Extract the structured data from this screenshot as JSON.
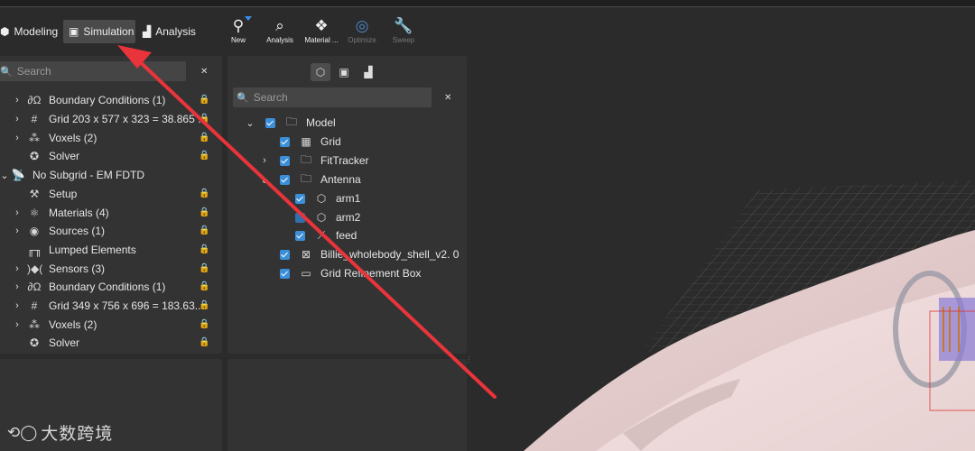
{
  "modes": {
    "modeling": "Modeling",
    "simulation": "Simulation",
    "analysis": "Analysis"
  },
  "tools": {
    "new": "New",
    "analysis": "Analysis",
    "material": "Material ...",
    "optimize": "Optimize",
    "sweep": "Sweep"
  },
  "left_panel": {
    "search_placeholder": "Search",
    "items": [
      {
        "label": "Boundary Conditions (1)",
        "icon": "boundary-conditions-icon"
      },
      {
        "label": "Grid 203 x 577 x 323 = 38.865 ...",
        "icon": "grid-icon"
      },
      {
        "label": "Voxels (2)",
        "icon": "voxels-icon"
      },
      {
        "label": "Solver",
        "icon": "solver-icon"
      },
      {
        "label": "No Subgrid - EM FDTD",
        "icon": "satellite-dish-icon"
      },
      {
        "label": "Setup",
        "icon": "setup-icon"
      },
      {
        "label": "Materials (4)",
        "icon": "materials-icon"
      },
      {
        "label": "Sources (1)",
        "icon": "sources-icon"
      },
      {
        "label": "Lumped Elements",
        "icon": "lumped-elements-icon"
      },
      {
        "label": "Sensors (3)",
        "icon": "sensors-icon"
      },
      {
        "label": "Boundary Conditions (1)",
        "icon": "boundary-conditions-icon"
      },
      {
        "label": "Grid 349 x 756 x 696 = 183.63...",
        "icon": "grid-icon"
      },
      {
        "label": "Voxels (2)",
        "icon": "voxels-icon"
      },
      {
        "label": "Solver",
        "icon": "solver-icon"
      }
    ]
  },
  "mid_panel": {
    "search_placeholder": "Search",
    "items": [
      {
        "label": "Model",
        "icon": "folder-icon"
      },
      {
        "label": "Grid",
        "icon": "grid-icon"
      },
      {
        "label": "FitTracker",
        "icon": "folder-icon"
      },
      {
        "label": "Antenna",
        "icon": "folder-icon"
      },
      {
        "label": "arm1",
        "icon": "solid-body-icon"
      },
      {
        "label": "arm2",
        "icon": "solid-body-icon"
      },
      {
        "label": "feed",
        "icon": "edge-icon"
      },
      {
        "label": "Billie_wholebody_shell_v2. 0",
        "icon": "mesh-icon"
      },
      {
        "label": "Grid Refinement Box",
        "icon": "box-icon"
      }
    ]
  },
  "watermark": {
    "text": "大数跨境"
  },
  "colors": {
    "accent": "#3b8fd9",
    "arrow": "#e8343a",
    "panel": "#333333",
    "background": "#2b2b2b"
  }
}
